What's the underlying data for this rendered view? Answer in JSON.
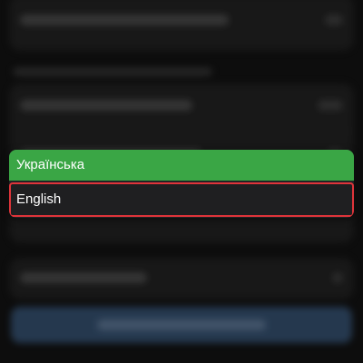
{
  "language_menu": {
    "options": [
      {
        "label": "Українська",
        "state": "selected"
      },
      {
        "label": "English",
        "state": "highlighted"
      }
    ],
    "colors": {
      "selected_bg": "#3aa645",
      "highlight_border": "#e0343a",
      "menu_bg": "#232325"
    }
  }
}
